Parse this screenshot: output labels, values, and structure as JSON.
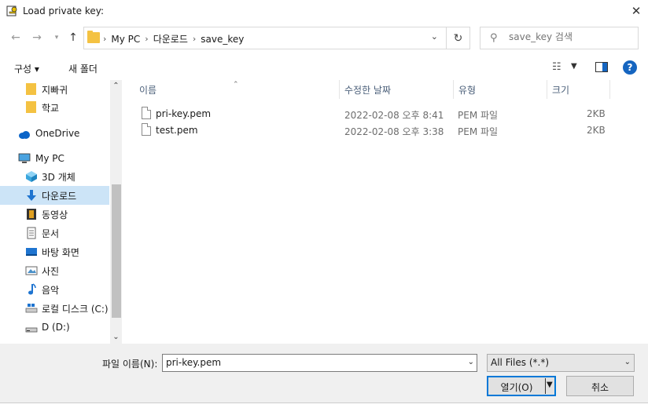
{
  "window": {
    "title": "Load private key:"
  },
  "address": {
    "crumbs": [
      "My PC",
      "다운로드",
      "save_key"
    ],
    "search_placeholder": "save_key 검색"
  },
  "toolbar": {
    "organize": "구성 ▾",
    "new_folder": "새 폴더"
  },
  "sidebar": {
    "items": [
      {
        "label": "지빠귀",
        "icon": "folder-icon"
      },
      {
        "label": "학교",
        "icon": "folder-icon"
      },
      {
        "label": "OneDrive",
        "icon": "cloud-icon"
      },
      {
        "label": "My PC",
        "icon": "computer-icon"
      },
      {
        "label": "3D 개체",
        "icon": "cube-icon"
      },
      {
        "label": "다운로드",
        "icon": "download-arrow-icon",
        "selected": true
      },
      {
        "label": "동영상",
        "icon": "film-icon"
      },
      {
        "label": "문서",
        "icon": "document-icon"
      },
      {
        "label": "바탕 화면",
        "icon": "desktop-icon"
      },
      {
        "label": "사진",
        "icon": "picture-icon"
      },
      {
        "label": "음악",
        "icon": "music-note-icon"
      },
      {
        "label": "로컬 디스크 (C:)",
        "icon": "drive-icon"
      },
      {
        "label": "D (D:)",
        "icon": "drive-icon"
      }
    ]
  },
  "columns": [
    "이름",
    "수정한 날짜",
    "유형",
    "크기"
  ],
  "files": [
    {
      "name": "pri-key.pem",
      "modified": "2022-02-08 오후 8:41",
      "type": "PEM 파일",
      "size": "2KB"
    },
    {
      "name": "test.pem",
      "modified": "2022-02-08 오후 3:38",
      "type": "PEM 파일",
      "size": "2KB"
    }
  ],
  "footer": {
    "filename_label": "파일 이름(N):",
    "filename_value": "pri-key.pem",
    "filetype_value": "All Files (*.*)",
    "open_label": "열기(O)",
    "cancel_label": "취소"
  },
  "colors": {
    "accent": "#0078d7",
    "selected_bg": "#cce4f7",
    "folder": "#f4c242"
  }
}
